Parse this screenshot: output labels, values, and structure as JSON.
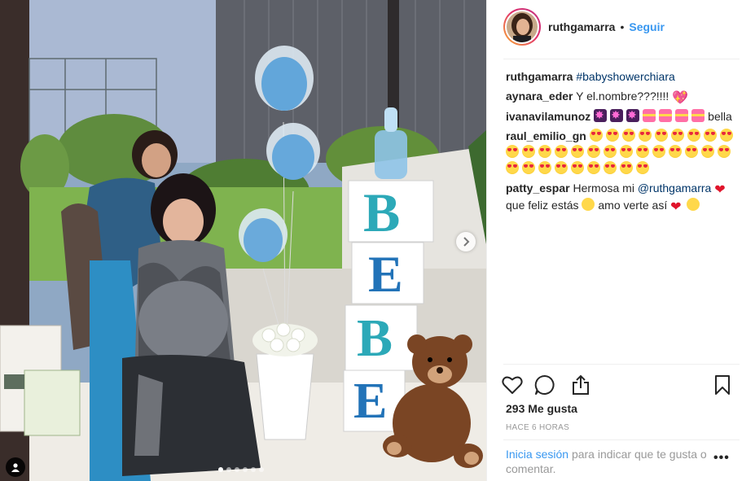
{
  "post": {
    "image_alt": "",
    "carousel_dots": 6,
    "carousel_active_index": 0,
    "blocks_letters": [
      "B",
      "E",
      "B",
      "E"
    ]
  },
  "header": {
    "username": "ruthgamarra",
    "separator": "•",
    "follow_label": "Seguir"
  },
  "comments": [
    {
      "user": "ruthgamarra",
      "parts": [
        {
          "type": "tag",
          "text": "#babyshowerchiara"
        }
      ]
    },
    {
      "user": "aynara_eder",
      "parts": [
        {
          "type": "text",
          "text": "Y el.nombre???!!!!"
        },
        {
          "type": "emoji",
          "name": "pink-heart",
          "glyph": "💖"
        }
      ]
    },
    {
      "user": "ivanavilamunoz",
      "parts": [
        {
          "type": "emoji",
          "name": "sparkle"
        },
        {
          "type": "emoji",
          "name": "sparkle"
        },
        {
          "type": "emoji",
          "name": "sparkle"
        },
        {
          "type": "emoji",
          "name": "gift-heart"
        },
        {
          "type": "emoji",
          "name": "gift-heart"
        },
        {
          "type": "emoji",
          "name": "gift-heart"
        },
        {
          "type": "emoji",
          "name": "gift-heart"
        },
        {
          "type": "text",
          "text": "bella"
        }
      ]
    },
    {
      "user": "raul_emilio_gn",
      "parts": [
        {
          "type": "emoji-repeat",
          "name": "heart-eyes",
          "count": 32
        }
      ]
    },
    {
      "user": "patty_espar",
      "parts": [
        {
          "type": "text",
          "text": "Hermosa mi"
        },
        {
          "type": "tag",
          "text": "@ruthgamarra"
        },
        {
          "type": "emoji",
          "name": "red-heart",
          "glyph": "❤"
        },
        {
          "type": "text",
          "text": "que feliz estás"
        },
        {
          "type": "emoji",
          "name": "smile"
        },
        {
          "type": "text",
          "text": "amo verte así"
        },
        {
          "type": "emoji",
          "name": "red-heart",
          "glyph": "❤"
        },
        {
          "type": "emoji",
          "name": "kiss"
        }
      ]
    }
  ],
  "actions": {
    "like_icon": "heart-outline-icon",
    "comment_icon": "comment-bubble-icon",
    "share_icon": "share-upload-icon",
    "save_icon": "bookmark-icon"
  },
  "likes_text": "293 Me gusta",
  "time_text": "HACE 6 HORAS",
  "login_prompt": {
    "link": "Inicia sesión",
    "rest": "para indicar que te gusta o comentar."
  },
  "more_label": "•••",
  "colors": {
    "link_blue": "#3897f0",
    "tag_blue": "#003569",
    "text": "#262626",
    "muted": "#999999"
  }
}
